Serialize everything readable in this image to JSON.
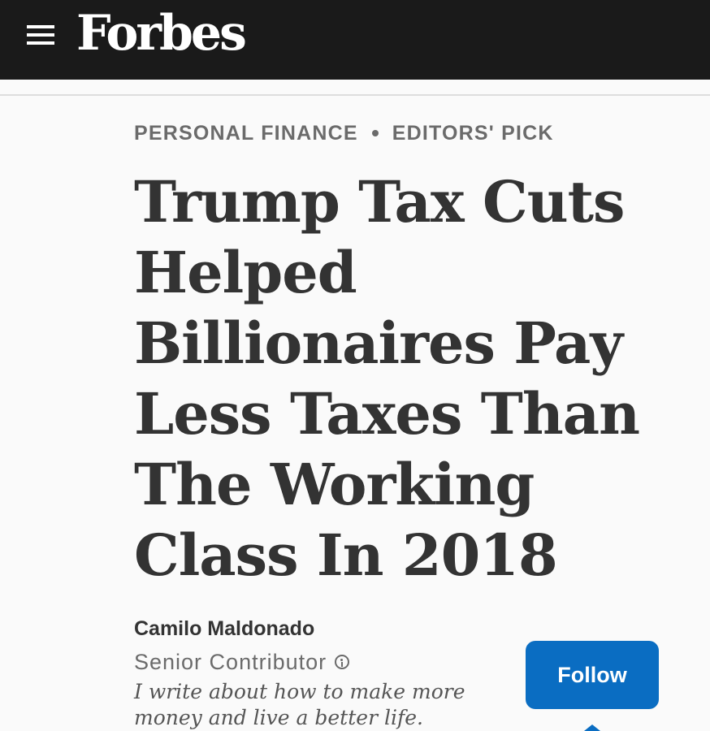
{
  "header": {
    "brand": "Forbes",
    "menu_icon": "hamburger-menu-icon"
  },
  "article": {
    "channel": "PERSONAL FINANCE",
    "tag": "EDITORS' PICK",
    "headline": "Trump Tax Cuts Helped Billionaires Pay Less Taxes Than The Working Class In 2018"
  },
  "author": {
    "name": "Camilo Maldonado",
    "role": "Senior Contributor",
    "bio": "I write about how to make more money and live a better life.",
    "follow_label": "Follow",
    "info_icon": "info-icon"
  },
  "colors": {
    "header_bg": "#1a1a1a",
    "accent_blue": "#0a6dc2",
    "headline_text": "#333333",
    "meta_gray": "#6b6b6b"
  }
}
